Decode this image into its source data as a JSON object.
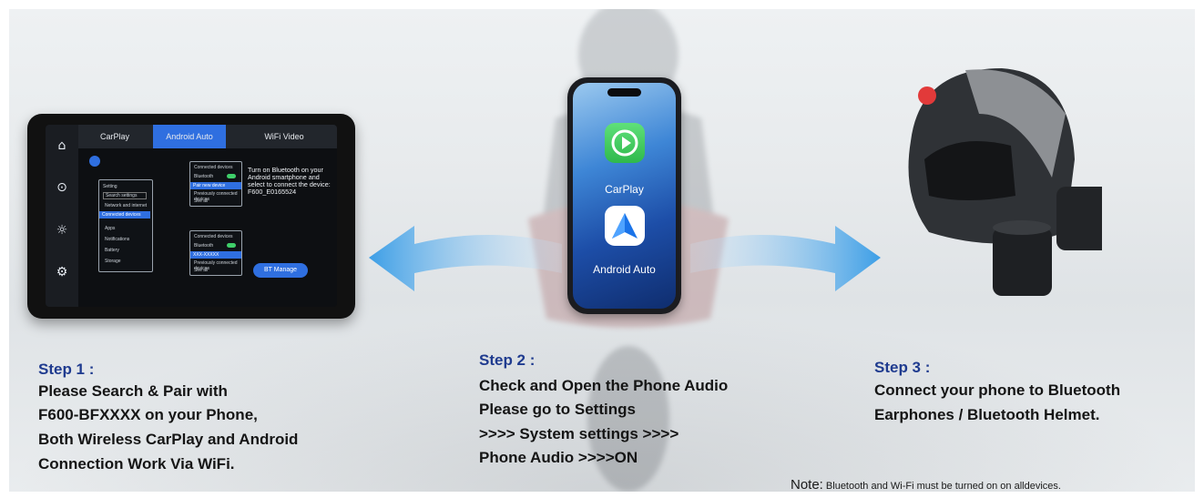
{
  "tablet": {
    "tabs": [
      "CarPlay",
      "Android Auto",
      "WiFi Video"
    ],
    "active_tab": "Android Auto",
    "sidebar_icons": [
      "home-icon",
      "play-icon",
      "brightness-icon",
      "settings-gear-icon"
    ],
    "instruction": "Turn on Bluetooth on your Android smartphone and select to connect the device: F600_E0165524",
    "button_label": "BT Manage",
    "mini_settings": {
      "title": "Setting",
      "search": "Search settings",
      "items": [
        "Network and internet",
        "Connected devices",
        "Apps",
        "Notifications",
        "Battery",
        "Storage"
      ],
      "connected_label": "Connected devices",
      "bluetooth_label": "Bluetooth",
      "pair_label": "Pair new device",
      "prev_label": "Previously connected devices",
      "see_all": "See all",
      "device_name": "XXX-XXXXX"
    }
  },
  "phone": {
    "apps": [
      {
        "name": "CarPlay",
        "icon": "carplay-icon"
      },
      {
        "name": "Android Auto",
        "icon": "android-auto-icon"
      }
    ]
  },
  "steps": [
    {
      "title": "Step 1 :",
      "lines": [
        "Please Search & Pair with",
        "F600-BFXXXX on your Phone,",
        "Both Wireless CarPlay and Android",
        "Connection Work Via WiFi."
      ]
    },
    {
      "title": "Step 2 :",
      "lines": [
        "Check and Open the Phone Audio",
        "Please go to Settings",
        ">>>> System settings >>>>",
        "Phone Audio >>>>ON"
      ]
    },
    {
      "title": "Step 3 :",
      "lines": [
        "Connect your phone to Bluetooth",
        "Earphones / Bluetooth Helmet."
      ]
    }
  ],
  "note": {
    "label": "Note:",
    "text": " Bluetooth and Wi-Fi must be turned on on alldevices."
  },
  "colors": {
    "step_title": "#1f3b8f",
    "arrow": "#4aa8ea",
    "accent_blue": "#2f6fe0"
  }
}
